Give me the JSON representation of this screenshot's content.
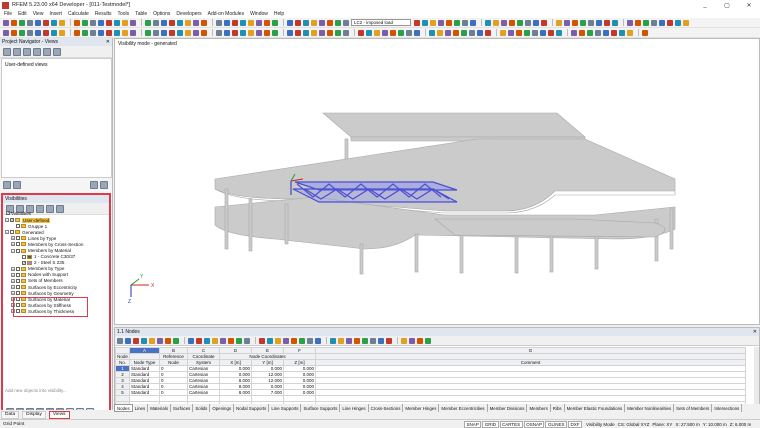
{
  "window": {
    "title": "RFEM 5.23.00 x64 Developer - [011-Testmodel*]",
    "controls": [
      "_",
      "▢",
      "✕"
    ]
  },
  "menu": [
    "File",
    "Edit",
    "View",
    "Insert",
    "Calculate",
    "Results",
    "Tools",
    "Table",
    "Options",
    "Developers",
    "Add-on Modules",
    "Window",
    "Help"
  ],
  "toolbar": {
    "load_case": "LC2 - imposed load"
  },
  "nav": {
    "title": "Project Navigator - Views",
    "user_defined_views": "User-defined views",
    "visibilities_title": "Visibilities",
    "visibilities_checkbox": "Visibilities",
    "tree": [
      {
        "level": 0,
        "expand": "−",
        "check": "✓",
        "folder": true,
        "label": "User-defined",
        "highlight": true
      },
      {
        "level": 1,
        "expand": "",
        "check": "",
        "folder": true,
        "label": "Gruppe 1"
      },
      {
        "level": 0,
        "expand": "−",
        "check": "",
        "folder": true,
        "label": "Generated"
      },
      {
        "level": 1,
        "expand": "+",
        "check": "",
        "folder": true,
        "label": "Lines by Type"
      },
      {
        "level": 1,
        "expand": "+",
        "check": "",
        "folder": true,
        "label": "Members by Cross-Section"
      },
      {
        "level": 1,
        "expand": "−",
        "check": "",
        "folder": true,
        "label": "Members by Material"
      },
      {
        "level": 2,
        "expand": "",
        "check": "",
        "folder": false,
        "label": "1 - Concrete C30/37"
      },
      {
        "level": 2,
        "expand": "",
        "check": "✓",
        "folder": false,
        "label": "2 - Steel S 235"
      },
      {
        "level": 1,
        "expand": "+",
        "check": "",
        "folder": true,
        "label": "Members by Type"
      },
      {
        "level": 1,
        "expand": "+",
        "check": "",
        "folder": true,
        "label": "Nodes with Support"
      },
      {
        "level": 1,
        "expand": "+",
        "check": "",
        "folder": true,
        "label": "Sets of Members"
      },
      {
        "level": 1,
        "expand": "+",
        "check": "",
        "folder": true,
        "label": "Surfaces by Eccentricity"
      },
      {
        "level": 1,
        "expand": "+",
        "check": "",
        "folder": true,
        "label": "Surfaces by Geometry"
      },
      {
        "level": 1,
        "expand": "+",
        "check": "",
        "folder": true,
        "label": "Surfaces by Material"
      },
      {
        "level": 1,
        "expand": "+",
        "check": "",
        "folder": true,
        "label": "Surfaces by Stiffness"
      },
      {
        "level": 1,
        "expand": "+",
        "check": "",
        "folder": true,
        "label": "Surfaces by Thickness"
      }
    ],
    "add_placeholder": "Add new objects into visibility...",
    "tabs": [
      "Data",
      "Display",
      "Views"
    ],
    "active_tab": "Views"
  },
  "view": {
    "mode": "Visibility mode - generated",
    "axis_labels": {
      "x": "X",
      "y": "Y",
      "z": "Z"
    }
  },
  "table": {
    "title": "1.1 Nodes",
    "letters": [
      "A",
      "B",
      "C",
      "D",
      "E",
      "F",
      "G"
    ],
    "headers": {
      "node": [
        "Node",
        "No."
      ],
      "node_type": [
        "",
        "Node Type"
      ],
      "reference": [
        "Reference",
        "Node"
      ],
      "coordinate": [
        "Coordinate",
        "System"
      ],
      "coords_group": "Node Coordinates",
      "x": "X [m]",
      "y": "Y [m]",
      "z": "Z [m]",
      "comment": "Comment"
    },
    "rows": [
      [
        "1",
        "Standard",
        "0",
        "Cartesian",
        "0.000",
        "0.000",
        "0.000",
        ""
      ],
      [
        "2",
        "Standard",
        "0",
        "Cartesian",
        "0.000",
        "12.000",
        "0.000",
        ""
      ],
      [
        "3",
        "Standard",
        "0",
        "Cartesian",
        "8.000",
        "12.000",
        "0.000",
        ""
      ],
      [
        "4",
        "Standard",
        "0",
        "Cartesian",
        "8.000",
        "0.000",
        "0.000",
        ""
      ],
      [
        "5",
        "Standard",
        "0",
        "Cartesian",
        "8.000",
        "7.000",
        "0.000",
        ""
      ]
    ],
    "tabs": [
      "Nodes",
      "Lines",
      "Materials",
      "Surfaces",
      "Solids",
      "Openings",
      "Nodal Supports",
      "Line Supports",
      "Surface Supports",
      "Line Hinges",
      "Cross-Sections",
      "Member Hinges",
      "Member Eccentricities",
      "Member Divisions",
      "Members",
      "Ribs",
      "Member Elastic Foundations",
      "Member Nonlinearities",
      "Sets of Members",
      "Intersections"
    ],
    "active_tab": "Nodes"
  },
  "status": {
    "left": "Grid Point",
    "buttons": [
      "SNAP",
      "GRID",
      "CARTES",
      "OSNAP",
      "GLINES",
      "DXF"
    ],
    "mode": "Visibility Mode",
    "cs": "CS: Global XYZ",
    "plane": "Plane: XY",
    "x": "X: 27.500 m",
    "y": "Y: 10.000 m",
    "z": "Z: 6.000 m"
  },
  "colors": {
    "highlight_red": "#e03a4a",
    "truss_blue": "#5a5fd8",
    "slab_gray": "#c8c8c8",
    "folder": "#f3c04d"
  }
}
